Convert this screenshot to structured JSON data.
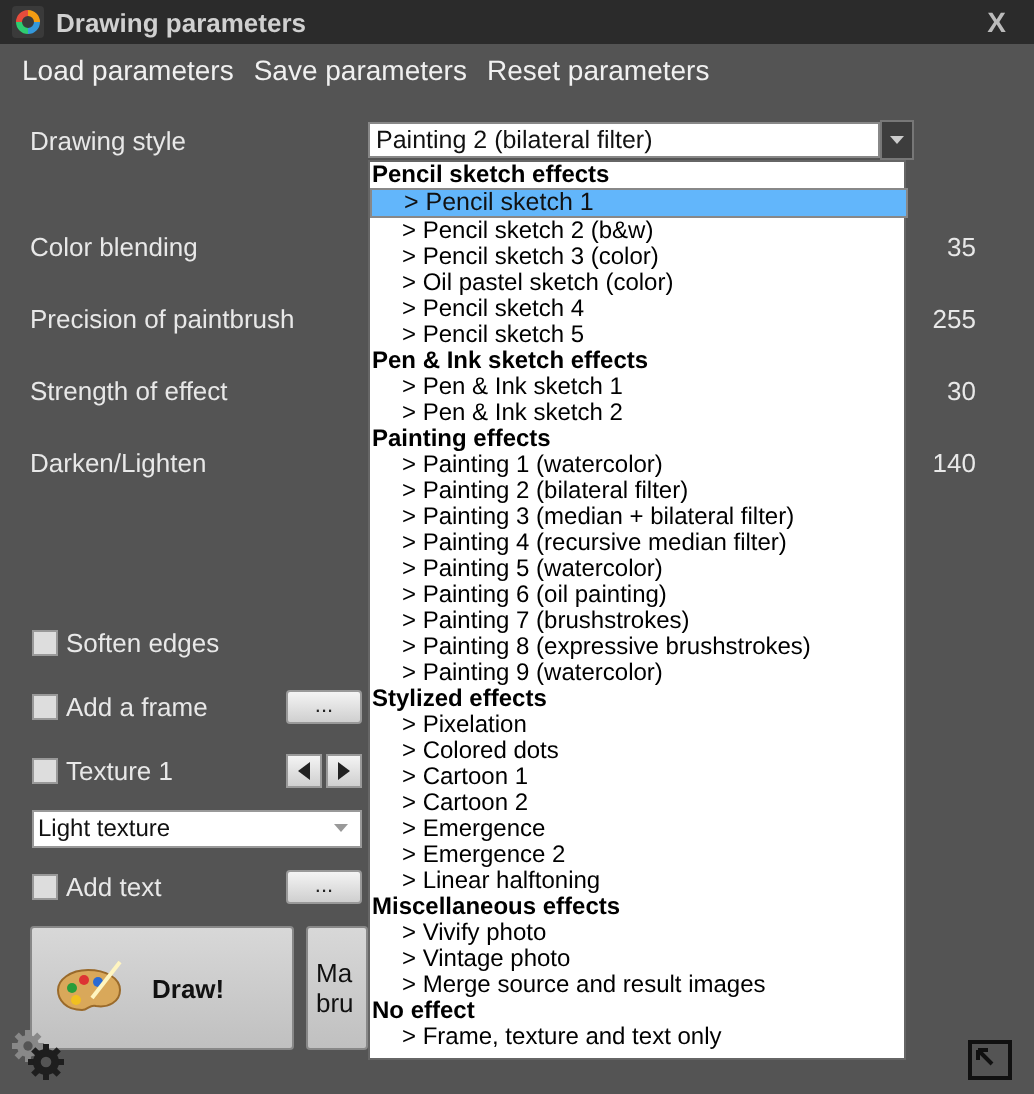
{
  "window": {
    "title": "Drawing parameters",
    "close": "X"
  },
  "menu": [
    {
      "label": "Load parameters"
    },
    {
      "label": "Save parameters"
    },
    {
      "label": "Reset parameters"
    }
  ],
  "drawing_style": {
    "label": "Drawing style",
    "value": "Painting 2 (bilateral filter)",
    "expanded": true
  },
  "style_list": [
    {
      "header": "Pencil sketch effects",
      "items": [
        {
          "label": "> Pencil sketch 1",
          "selected": true
        },
        {
          "label": "> Pencil sketch 2 (b&w)",
          "selected": false
        },
        {
          "label": "> Pencil sketch 3 (color)",
          "selected": false
        },
        {
          "label": "> Oil pastel sketch (color)",
          "selected": false
        },
        {
          "label": "> Pencil sketch 4",
          "selected": false
        },
        {
          "label": "> Pencil sketch 5",
          "selected": false
        }
      ]
    },
    {
      "header": "Pen & Ink sketch effects",
      "items": [
        {
          "label": "> Pen & Ink sketch 1",
          "selected": false
        },
        {
          "label": "> Pen & Ink sketch 2",
          "selected": false
        }
      ]
    },
    {
      "header": "Painting effects",
      "items": [
        {
          "label": "> Painting 1 (watercolor)",
          "selected": false
        },
        {
          "label": "> Painting 2 (bilateral filter)",
          "selected": false
        },
        {
          "label": "> Painting 3 (median + bilateral filter)",
          "selected": false
        },
        {
          "label": "> Painting 4 (recursive median filter)",
          "selected": false
        },
        {
          "label": "> Painting 5 (watercolor)",
          "selected": false
        },
        {
          "label": "> Painting 6 (oil painting)",
          "selected": false
        },
        {
          "label": "> Painting 7 (brushstrokes)",
          "selected": false
        },
        {
          "label": "> Painting 8 (expressive brushstrokes)",
          "selected": false
        },
        {
          "label": "> Painting 9 (watercolor)",
          "selected": false
        }
      ]
    },
    {
      "header": "Stylized effects",
      "items": [
        {
          "label": "> Pixelation",
          "selected": false
        },
        {
          "label": "> Colored dots",
          "selected": false
        },
        {
          "label": "> Cartoon 1",
          "selected": false
        },
        {
          "label": "> Cartoon 2",
          "selected": false
        },
        {
          "label": "> Emergence",
          "selected": false
        },
        {
          "label": "> Emergence 2",
          "selected": false
        },
        {
          "label": "> Linear halftoning",
          "selected": false
        }
      ]
    },
    {
      "header": "Miscellaneous effects",
      "items": [
        {
          "label": "> Vivify photo",
          "selected": false
        },
        {
          "label": "> Vintage photo",
          "selected": false
        },
        {
          "label": "> Merge source and result images",
          "selected": false
        }
      ]
    },
    {
      "header": "No effect",
      "items": [
        {
          "label": "> Frame, texture and text only",
          "selected": false
        }
      ]
    }
  ],
  "parameters": [
    {
      "label": "Color blending",
      "value": "35"
    },
    {
      "label": "Precision of paintbrush",
      "value": "255"
    },
    {
      "label": "Strength of effect",
      "value": "30"
    },
    {
      "label": "Darken/Lighten",
      "value": "140"
    }
  ],
  "options": [
    {
      "kind": "checkbox",
      "label": "Soften edges",
      "checked": false
    },
    {
      "kind": "checkbox",
      "label": "Add a frame",
      "checked": false,
      "button": "..."
    },
    {
      "kind": "checkbox-arrows",
      "label": "Texture 1",
      "checked": false
    },
    {
      "kind": "select",
      "value": "Light texture"
    },
    {
      "kind": "checkbox",
      "label": "Add text",
      "checked": false,
      "button": "..."
    }
  ],
  "actions": [
    {
      "kind": "draw",
      "lines": [
        "Draw!"
      ]
    },
    {
      "kind": "plain",
      "lines": [
        "Ma",
        "bru"
      ]
    }
  ]
}
